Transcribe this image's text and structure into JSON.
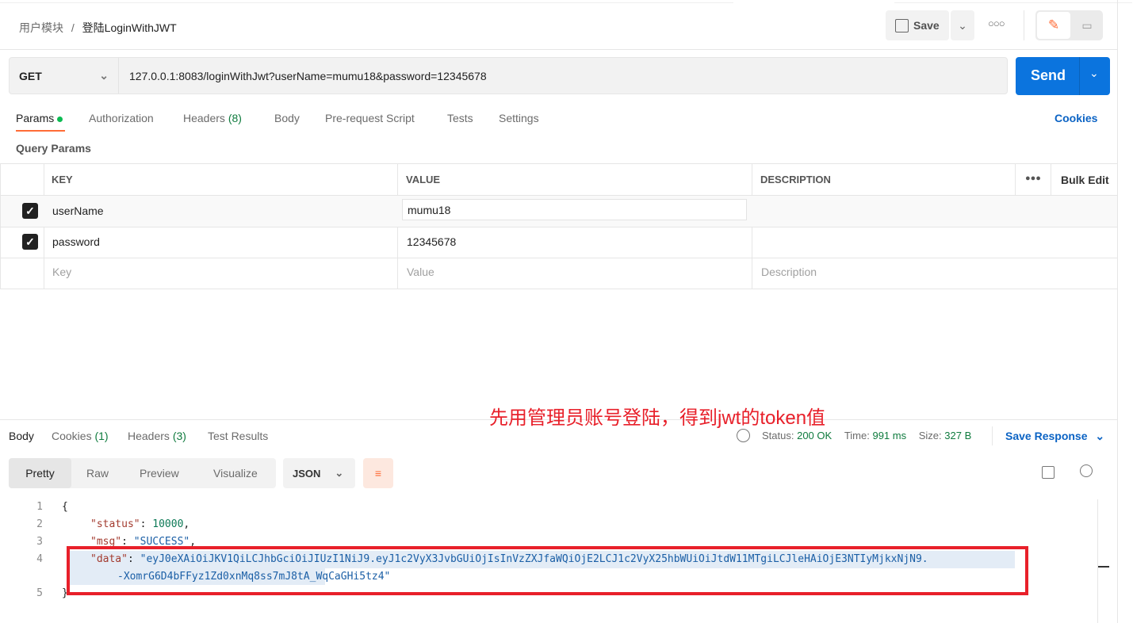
{
  "breadcrumb": {
    "parent": "用户模块",
    "separator": "/",
    "current": "登陆LoginWithJWT"
  },
  "toolbar": {
    "save_label": "Save"
  },
  "request": {
    "method": "GET",
    "url": "127.0.0.1:8083/loginWithJwt?userName=mumu18&password=12345678",
    "send_label": "Send"
  },
  "tabs": [
    {
      "label": "Params"
    },
    {
      "label": "Authorization"
    },
    {
      "label": "Headers",
      "count": "(8)"
    },
    {
      "label": "Body"
    },
    {
      "label": "Pre-request Script"
    },
    {
      "label": "Tests"
    },
    {
      "label": "Settings"
    }
  ],
  "cookies_label": "Cookies",
  "query_params": {
    "title": "Query Params",
    "headers": [
      "KEY",
      "VALUE",
      "DESCRIPTION"
    ],
    "bulk_edit": "Bulk Edit",
    "rows": [
      {
        "checked": true,
        "key": "userName",
        "value": "mumu18"
      },
      {
        "checked": true,
        "key": "password",
        "value": "12345678"
      }
    ],
    "placeholders": {
      "key": "Key",
      "value": "Value",
      "description": "Description"
    }
  },
  "response": {
    "tabs": [
      {
        "label": "Body"
      },
      {
        "label": "Cookies",
        "count": "(1)"
      },
      {
        "label": "Headers",
        "count": "(3)"
      },
      {
        "label": "Test Results"
      }
    ],
    "status_label": "Status:",
    "status": "200 OK",
    "time_label": "Time:",
    "time": "991 ms",
    "size_label": "Size:",
    "size": "327 B",
    "save_response": "Save Response",
    "view_tabs": [
      "Pretty",
      "Raw",
      "Preview",
      "Visualize"
    ],
    "format": "JSON",
    "lines": {
      "l1": "{",
      "status_key": "\"status\"",
      "status_val": "10000",
      "msg_key": "\"msg\"",
      "msg_val": "\"SUCCESS\"",
      "data_key": "\"data\"",
      "data_val1": "\"eyJ0eXAiOiJKV1QiLCJhbGciOiJIUzI1NiJ9.eyJ1c2VyX3JvbGUiOjIsInVzZXJfaWQiOjE2LCJ1c2VyX25hbWUiOiJtdW11MTgiLCJleHAiOjE3NTIyMjkxNjN9.",
      "data_val2": "-XomrG6D4bFFyz1Zd0xnMq8ss7mJ8tA_WqCaGHi5tz4\"",
      "l5": "}"
    },
    "line_numbers": [
      "1",
      "2",
      "3",
      "4",
      "5"
    ]
  },
  "annotation": "先用管理员账号登陆，得到jwt的token值",
  "colors": {
    "accent": "#ff6c37",
    "send": "#0b74de",
    "annotation": "#e8202a"
  }
}
